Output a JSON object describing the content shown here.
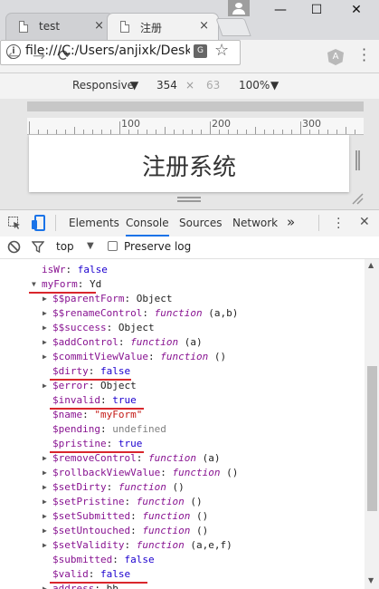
{
  "browser": {
    "tabs": [
      {
        "label": "test",
        "close": "×"
      },
      {
        "label": "注册",
        "close": "×"
      }
    ],
    "window_controls": {
      "minimize": "—",
      "maximize": "☐",
      "close": "✕"
    },
    "address": {
      "info": "i",
      "url": "file:///C:/Users/anjixk/Desk",
      "translate": "G",
      "bookmark": "☆"
    },
    "extension": "A",
    "nav": {
      "back": "←",
      "forward": "→",
      "reload": "⟳"
    }
  },
  "device_toolbar": {
    "device": "Responsive",
    "width": "354",
    "separator": "×",
    "height": "63",
    "zoom": "100%"
  },
  "ruler": {
    "labels": [
      "100",
      "200",
      "300"
    ]
  },
  "page": {
    "title": "注册系统"
  },
  "devtools": {
    "tabs": [
      "Elements",
      "Console",
      "Sources",
      "Network"
    ],
    "more": "»",
    "context": "top",
    "preserve_log": "Preserve log"
  },
  "console": {
    "rows": [
      {
        "indent": 0,
        "arrow": "",
        "key": "isWr",
        "type": "bool",
        "value": "false",
        "args": "",
        "top": true
      },
      {
        "indent": 0,
        "arrow": "▼",
        "key": "myForm",
        "type": "obj",
        "value": "Yd",
        "args": "",
        "underline": 74
      },
      {
        "indent": 1,
        "arrow": "▶",
        "key": "$$parentForm",
        "type": "obj",
        "value": "Object",
        "args": ""
      },
      {
        "indent": 1,
        "arrow": "▶",
        "key": "$$renameControl",
        "type": "fn",
        "value": "function",
        "args": " (a,b)"
      },
      {
        "indent": 1,
        "arrow": "▶",
        "key": "$$success",
        "type": "obj",
        "value": "Object",
        "args": ""
      },
      {
        "indent": 1,
        "arrow": "▶",
        "key": "$addControl",
        "type": "fn",
        "value": "function",
        "args": " (a)"
      },
      {
        "indent": 1,
        "arrow": "▶",
        "key": "$commitViewValue",
        "type": "fn",
        "value": "function",
        "args": " ()"
      },
      {
        "indent": 1,
        "arrow": "",
        "key": "$dirty",
        "type": "bool",
        "value": "false",
        "args": "",
        "underline": 90
      },
      {
        "indent": 1,
        "arrow": "▶",
        "key": "$error",
        "type": "obj",
        "value": "Object",
        "args": ""
      },
      {
        "indent": 1,
        "arrow": "",
        "key": "$invalid",
        "type": "bool",
        "value": "true",
        "args": "",
        "underline": 104
      },
      {
        "indent": 1,
        "arrow": "",
        "key": "$name",
        "type": "str",
        "value": "\"myForm\"",
        "args": ""
      },
      {
        "indent": 1,
        "arrow": "",
        "key": "$pending",
        "type": "undef",
        "value": "undefined",
        "args": ""
      },
      {
        "indent": 1,
        "arrow": "",
        "key": "$pristine",
        "type": "bool",
        "value": "true",
        "args": "",
        "underline": 104
      },
      {
        "indent": 1,
        "arrow": "▶",
        "key": "$removeControl",
        "type": "fn",
        "value": "function",
        "args": " (a)"
      },
      {
        "indent": 1,
        "arrow": "▶",
        "key": "$rollbackViewValue",
        "type": "fn",
        "value": "function",
        "args": " ()"
      },
      {
        "indent": 1,
        "arrow": "▶",
        "key": "$setDirty",
        "type": "fn",
        "value": "function",
        "args": " ()"
      },
      {
        "indent": 1,
        "arrow": "▶",
        "key": "$setPristine",
        "type": "fn",
        "value": "function",
        "args": " ()"
      },
      {
        "indent": 1,
        "arrow": "▶",
        "key": "$setSubmitted",
        "type": "fn",
        "value": "function",
        "args": " ()"
      },
      {
        "indent": 1,
        "arrow": "▶",
        "key": "$setUntouched",
        "type": "fn",
        "value": "function",
        "args": " ()"
      },
      {
        "indent": 1,
        "arrow": "▶",
        "key": "$setValidity",
        "type": "fn",
        "value": "function",
        "args": " (a,e,f)"
      },
      {
        "indent": 1,
        "arrow": "",
        "key": "$submitted",
        "type": "bool",
        "value": "false",
        "args": ""
      },
      {
        "indent": 1,
        "arrow": "",
        "key": "$valid",
        "type": "bool",
        "value": "false",
        "args": "",
        "underline": 108
      },
      {
        "indent": 1,
        "arrow": "▶",
        "key": "address",
        "type": "obj",
        "value": "bb",
        "args": ""
      }
    ]
  },
  "colors": {
    "annotation_underline": "#d9262c",
    "active_tab": "#1a73e8"
  }
}
